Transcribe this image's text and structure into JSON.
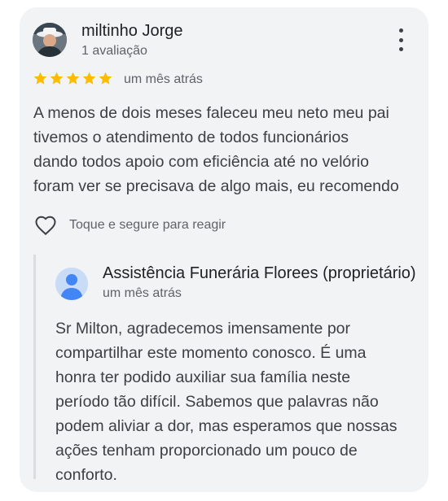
{
  "review": {
    "author_name": "miltinho Jorge",
    "author_meta": "1 avaliação",
    "rating": 5,
    "rating_max": 5,
    "star_color": "#fbbc04",
    "time": "um mês atrás",
    "lines": [
      "A menos de dois meses faleceu meu neto meu pai",
      "tivemos o atendimento de todos funcionários",
      "dando todos apoio com eficiência até no velório",
      "foram ver se precisava de algo mais, eu recomendo"
    ],
    "react_label": "Toque e segure para reagir",
    "icons": {
      "menu": "more-vert-icon",
      "react": "heart-outline-icon"
    }
  },
  "reply": {
    "owner_name": "Assistência Funerária Florees (proprietário)",
    "time": "um mês atrás",
    "lines": [
      "Sr Milton, agradecemos imensamente por",
      "compartilhar este momento conosco. É uma",
      "honra ter podido auxiliar sua família neste",
      "período tão difícil. Sabemos que palavras não",
      "podem aliviar a dor, mas esperamos que nossas",
      "ações tenham proporcionado um pouco de",
      "conforto."
    ],
    "avatar_icon": "default-profile-icon",
    "avatar_color": "#4285f4"
  }
}
